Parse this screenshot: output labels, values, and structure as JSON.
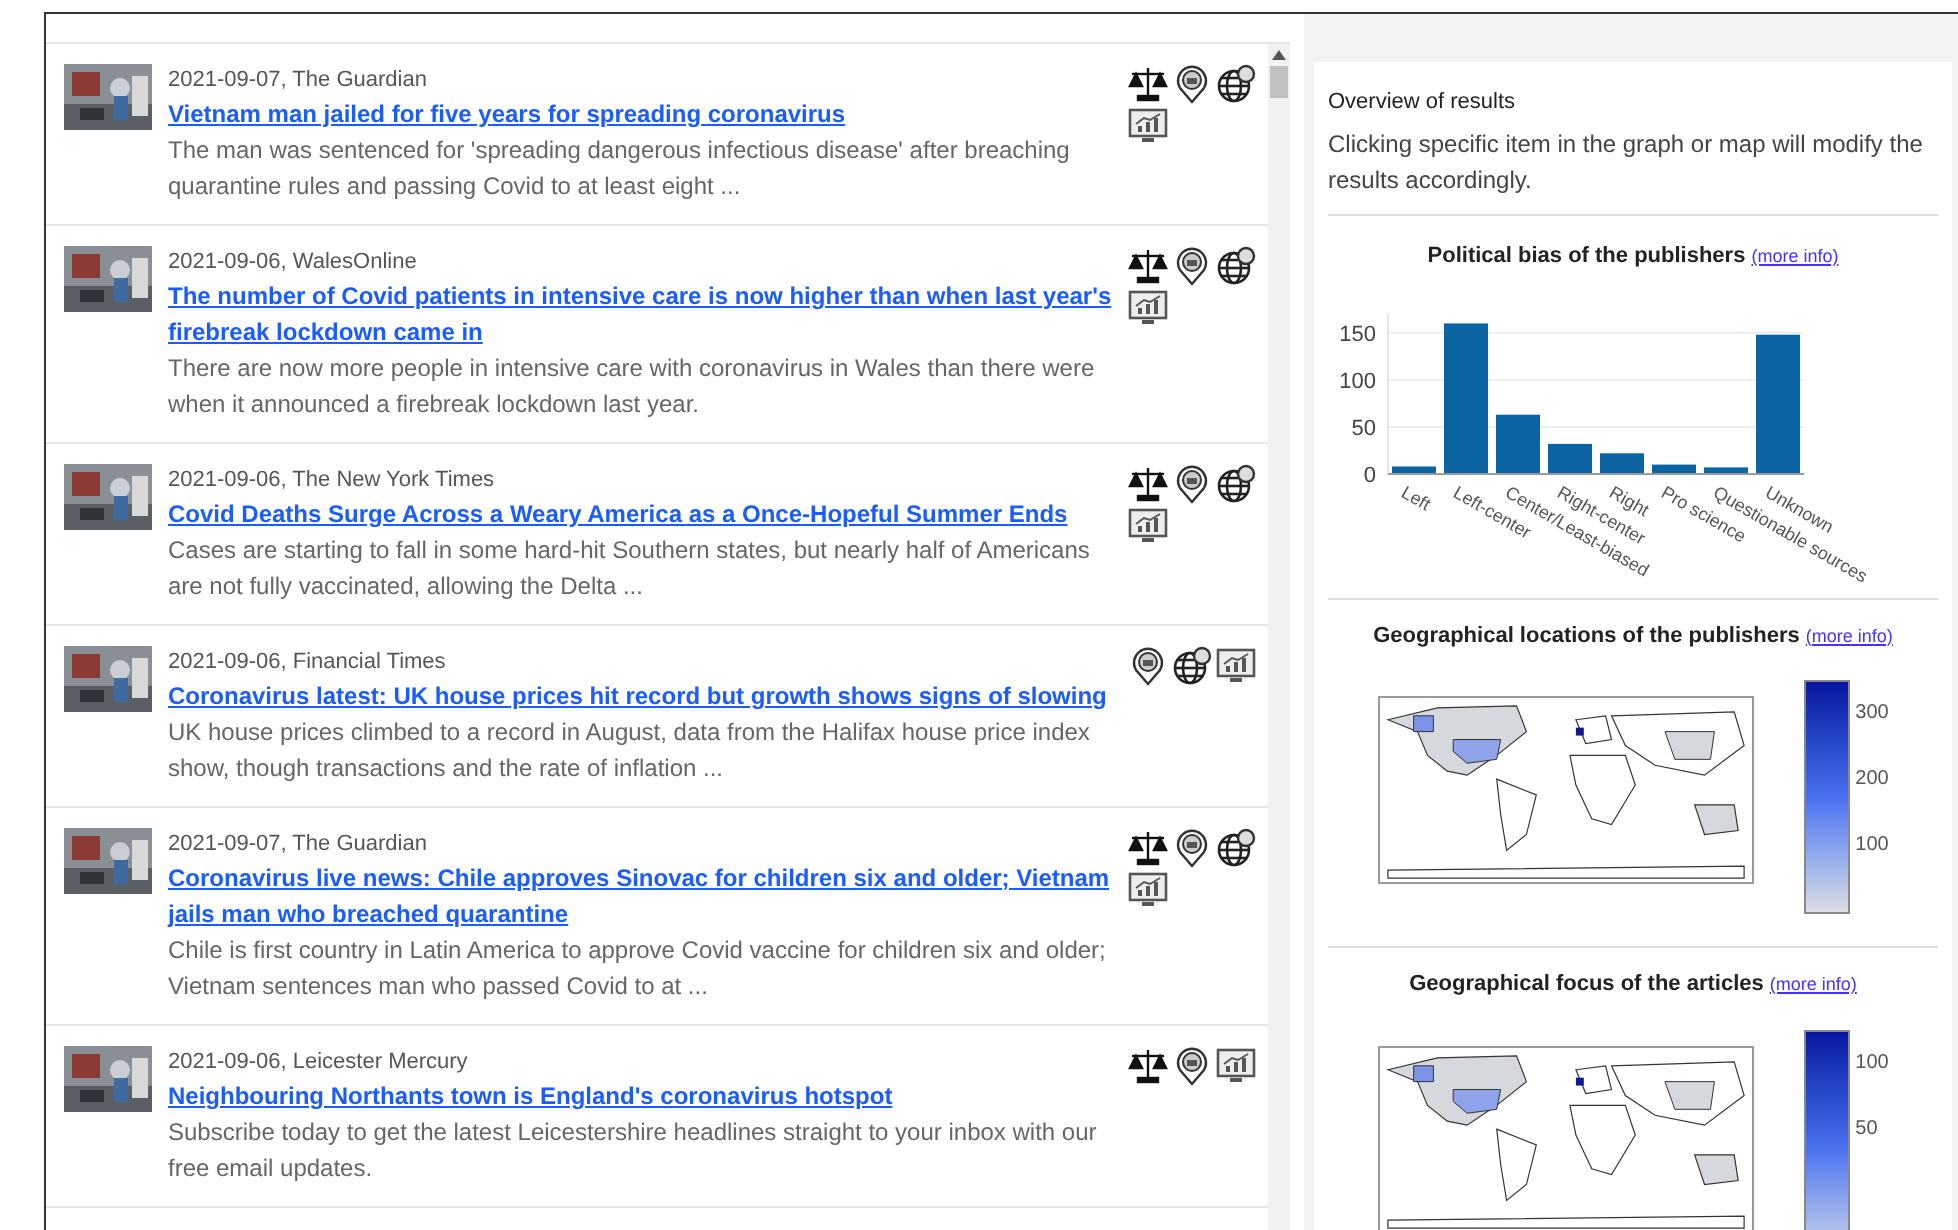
{
  "articles": [
    {
      "meta": "2021-09-07, The Guardian",
      "title": "Vietnam man jailed for five years for spreading coronavirus",
      "summary": "The man was sentenced for 'spreading dangerous infectious disease' after breaching quarantine rules and passing Covid to at least eight ...",
      "bias_icon": true,
      "location_icon": true,
      "focus_icon": true,
      "stats_icon": true
    },
    {
      "meta": "2021-09-06, WalesOnline",
      "title": "The number of Covid patients in intensive care is now higher than when last year's firebreak lockdown came in",
      "summary": "There are now more people in intensive care with coronavirus in Wales than there were when it announced a firebreak lockdown last year.",
      "bias_icon": true,
      "location_icon": true,
      "focus_icon": true,
      "stats_icon": true
    },
    {
      "meta": "2021-09-06, The New York Times",
      "title": "Covid Deaths Surge Across a Weary America as a Once-Hopeful Summer Ends",
      "summary": "Cases are starting to fall in some hard-hit Southern states, but nearly half of Americans are not fully vaccinated, allowing the Delta ...",
      "bias_icon": true,
      "location_icon": true,
      "focus_icon": true,
      "stats_icon": true
    },
    {
      "meta": "2021-09-06, Financial Times",
      "title": "Coronavirus latest: UK house prices hit record but growth shows signs of slowing",
      "summary": "UK house prices climbed to a record in August, data from the Halifax house price index show, though transactions and the rate of inflation ...",
      "bias_icon": false,
      "location_icon": true,
      "focus_icon": true,
      "stats_icon": true
    },
    {
      "meta": "2021-09-07, The Guardian",
      "title": "Coronavirus live news: Chile approves Sinovac for children six and older; Vietnam jails man who breached quarantine",
      "summary": "Chile is first country in Latin America to approve Covid vaccine for children six and older; Vietnam sentences man who passed Covid to at ...",
      "bias_icon": true,
      "location_icon": true,
      "focus_icon": true,
      "stats_icon": true
    },
    {
      "meta": "2021-09-06, Leicester Mercury",
      "title": "Neighbouring Northants town is England's coronavirus hotspot",
      "summary": "Subscribe today to get the latest Leicestershire headlines straight to your inbox with our free email updates.",
      "bias_icon": true,
      "location_icon": true,
      "focus_icon": false,
      "stats_icon": true
    }
  ],
  "overview": {
    "title": "Overview of results",
    "description": "Clicking specific item in the graph or map will modify the results accordingly.",
    "bias": {
      "title": "Political bias of the publishers",
      "link": "(more info)",
      "chart_data": {
        "type": "bar",
        "categories": [
          "Left",
          "Left-center",
          "Center/Least-biased",
          "Right-center",
          "Right",
          "Pro science",
          "Questionable sources",
          "Unknown"
        ],
        "series": [
          {
            "color": "#0a64a4",
            "values": [
              8,
              160,
              63,
              32,
              22,
              10,
              7,
              148
            ]
          }
        ],
        "ylim": [
          0,
          170
        ],
        "yticks": [
          0,
          50,
          100,
          150
        ],
        "grid": true
      }
    },
    "maps": [
      {
        "title": "Geographical locations of the publishers",
        "link": "(more info)",
        "scale_ticks": [
          "300",
          "200",
          "100"
        ]
      },
      {
        "title": "Geographical focus of the articles",
        "link": "(more info)",
        "scale_ticks": [
          "100",
          "50"
        ]
      }
    ]
  }
}
